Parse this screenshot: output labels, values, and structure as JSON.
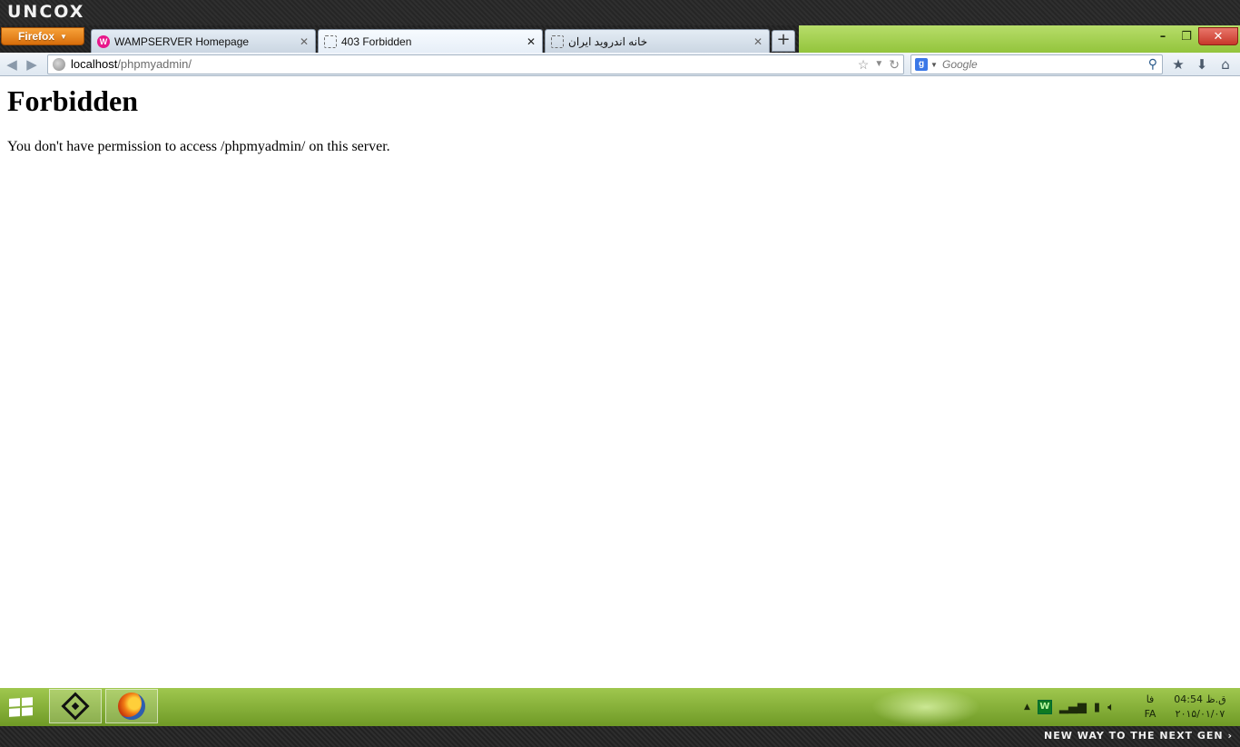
{
  "brand": {
    "logo_text": "UNCOX",
    "tagline": "NEW WAY TO THE NEXT GEN ›"
  },
  "browser": {
    "menu_button_label": "Firefox",
    "tabs": [
      {
        "title": "WAMPSERVER Homepage",
        "icon": "wampserver-icon",
        "active": false
      },
      {
        "title": "403 Forbidden",
        "icon": "blank-page-icon",
        "active": true
      },
      {
        "title": "خانه اندروید ایران",
        "icon": "blank-page-icon",
        "active": false
      }
    ],
    "new_tab_label": "+",
    "window_controls": {
      "minimize": "–",
      "restore": "❐",
      "close": "✕"
    },
    "url": {
      "host": "localhost",
      "path": "/phpmyadmin/"
    },
    "search": {
      "engine": "Google",
      "placeholder": "Google"
    }
  },
  "page": {
    "heading": "Forbidden",
    "message": "You don't have permission to access /phpmyadmin/ on this server."
  },
  "taskbar": {
    "pinned_apps": [
      "uncox-app",
      "firefox"
    ],
    "tray": {
      "language_top": "فا",
      "language_bottom": "FA",
      "time": "04:54 ق.ظ",
      "date": "۲۰۱۵/۰۱/۰۷"
    }
  },
  "colors": {
    "accent_green": "#93c43c",
    "firefox_orange": "#e8821a",
    "close_red": "#c7382a"
  }
}
